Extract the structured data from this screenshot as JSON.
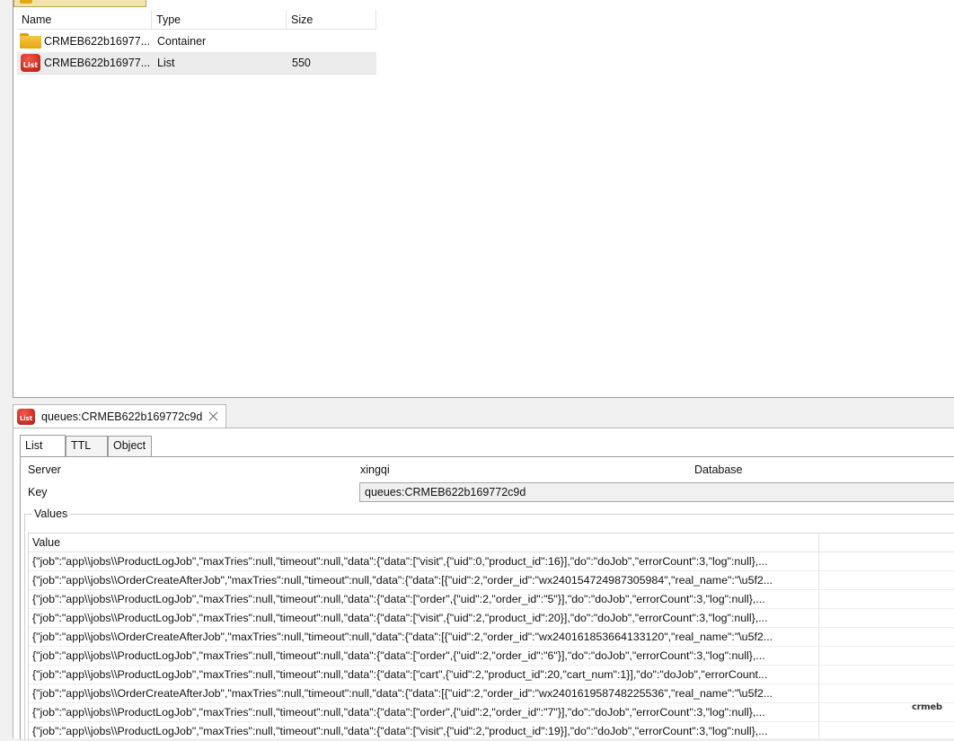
{
  "keys_table": {
    "columns": [
      "Name",
      "Type",
      "Size"
    ],
    "rows": [
      {
        "name": "CRMEB622b16977...",
        "type": "Container",
        "size": "",
        "icon": "folder-icon"
      },
      {
        "name": "CRMEB622b16977...",
        "type": "List",
        "size": "550",
        "icon": "list-icon"
      }
    ]
  },
  "icons": {
    "list_label": "List"
  },
  "editor": {
    "tab_title": "queues:CRMEB622b169772c9d",
    "subtabs": [
      "List",
      "TTL",
      "Object"
    ],
    "server_label": "Server",
    "server_value": "xingqi",
    "database_label": "Database",
    "key_label": "Key",
    "key_value": "queues:CRMEB622b169772c9d",
    "values_label": "Values",
    "value_header": "Value",
    "values": [
      "{\"job\":\"app\\\\jobs\\\\ProductLogJob\",\"maxTries\":null,\"timeout\":null,\"data\":{\"data\":[\"visit\",{\"uid\":0,\"product_id\":16}],\"do\":\"doJob\",\"errorCount\":3,\"log\":null},...",
      "{\"job\":\"app\\\\jobs\\\\OrderCreateAfterJob\",\"maxTries\":null,\"timeout\":null,\"data\":{\"data\":[{\"uid\":2,\"order_id\":\"wx240154724987305984\",\"real_name\":\"\\u5f2...",
      "{\"job\":\"app\\\\jobs\\\\ProductLogJob\",\"maxTries\":null,\"timeout\":null,\"data\":{\"data\":[\"order\",{\"uid\":2,\"order_id\":\"5\"}],\"do\":\"doJob\",\"errorCount\":3,\"log\":null},...",
      "{\"job\":\"app\\\\jobs\\\\ProductLogJob\",\"maxTries\":null,\"timeout\":null,\"data\":{\"data\":[\"visit\",{\"uid\":2,\"product_id\":20}],\"do\":\"doJob\",\"errorCount\":3,\"log\":null},...",
      "{\"job\":\"app\\\\jobs\\\\OrderCreateAfterJob\",\"maxTries\":null,\"timeout\":null,\"data\":{\"data\":[{\"uid\":2,\"order_id\":\"wx240161853664133120\",\"real_name\":\"\\u5f2...",
      "{\"job\":\"app\\\\jobs\\\\ProductLogJob\",\"maxTries\":null,\"timeout\":null,\"data\":{\"data\":[\"order\",{\"uid\":2,\"order_id\":\"6\"}],\"do\":\"doJob\",\"errorCount\":3,\"log\":null},...",
      "{\"job\":\"app\\\\jobs\\\\ProductLogJob\",\"maxTries\":null,\"timeout\":null,\"data\":{\"data\":[\"cart\",{\"uid\":2,\"product_id\":20,\"cart_num\":1}],\"do\":\"doJob\",\"errorCount...",
      "{\"job\":\"app\\\\jobs\\\\OrderCreateAfterJob\",\"maxTries\":null,\"timeout\":null,\"data\":{\"data\":[{\"uid\":2,\"order_id\":\"wx240161958748225536\",\"real_name\":\"\\u5f2...",
      "{\"job\":\"app\\\\jobs\\\\ProductLogJob\",\"maxTries\":null,\"timeout\":null,\"data\":{\"data\":[\"order\",{\"uid\":2,\"order_id\":\"7\"}],\"do\":\"doJob\",\"errorCount\":3,\"log\":null},...",
      "{\"job\":\"app\\\\jobs\\\\ProductLogJob\",\"maxTries\":null,\"timeout\":null,\"data\":{\"data\":[\"visit\",{\"uid\":2,\"product_id\":19}],\"do\":\"doJob\",\"errorCount\":3,\"log\":null},..."
    ]
  },
  "watermark": "crmeb"
}
